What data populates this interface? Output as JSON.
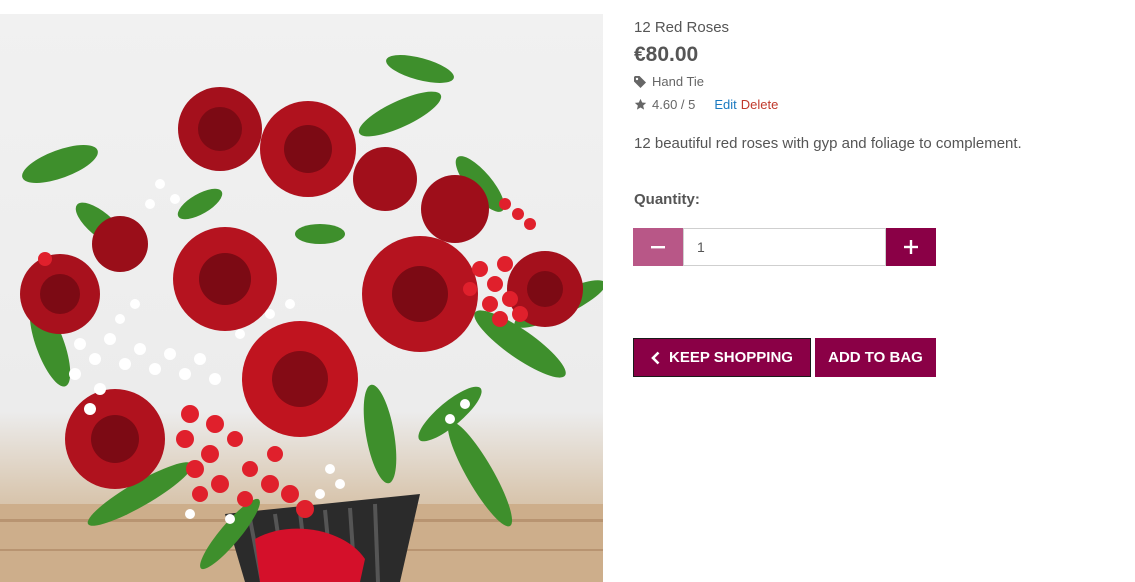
{
  "product": {
    "name": "12 Red Roses",
    "price": "€80.00",
    "category_icon": "tag-icon",
    "category": "Hand Tie",
    "rating_icon": "star-icon",
    "rating": "4.60 / 5",
    "edit_label": "Edit",
    "delete_label": "Delete",
    "description": "12 beautiful red roses with gyp and foliage to complement."
  },
  "quantity": {
    "label": "Quantity:",
    "value": "1",
    "decrement_icon": "minus-icon",
    "increment_icon": "plus-icon"
  },
  "actions": {
    "keep_shopping_icon": "chevron-left-icon",
    "keep_shopping": "KEEP SHOPPING",
    "add_to_bag": "ADD TO BAG"
  },
  "colors": {
    "brand": "#8a0046",
    "brand_light": "#b85787",
    "link": "#1a7ac0",
    "danger": "#c0392b"
  }
}
